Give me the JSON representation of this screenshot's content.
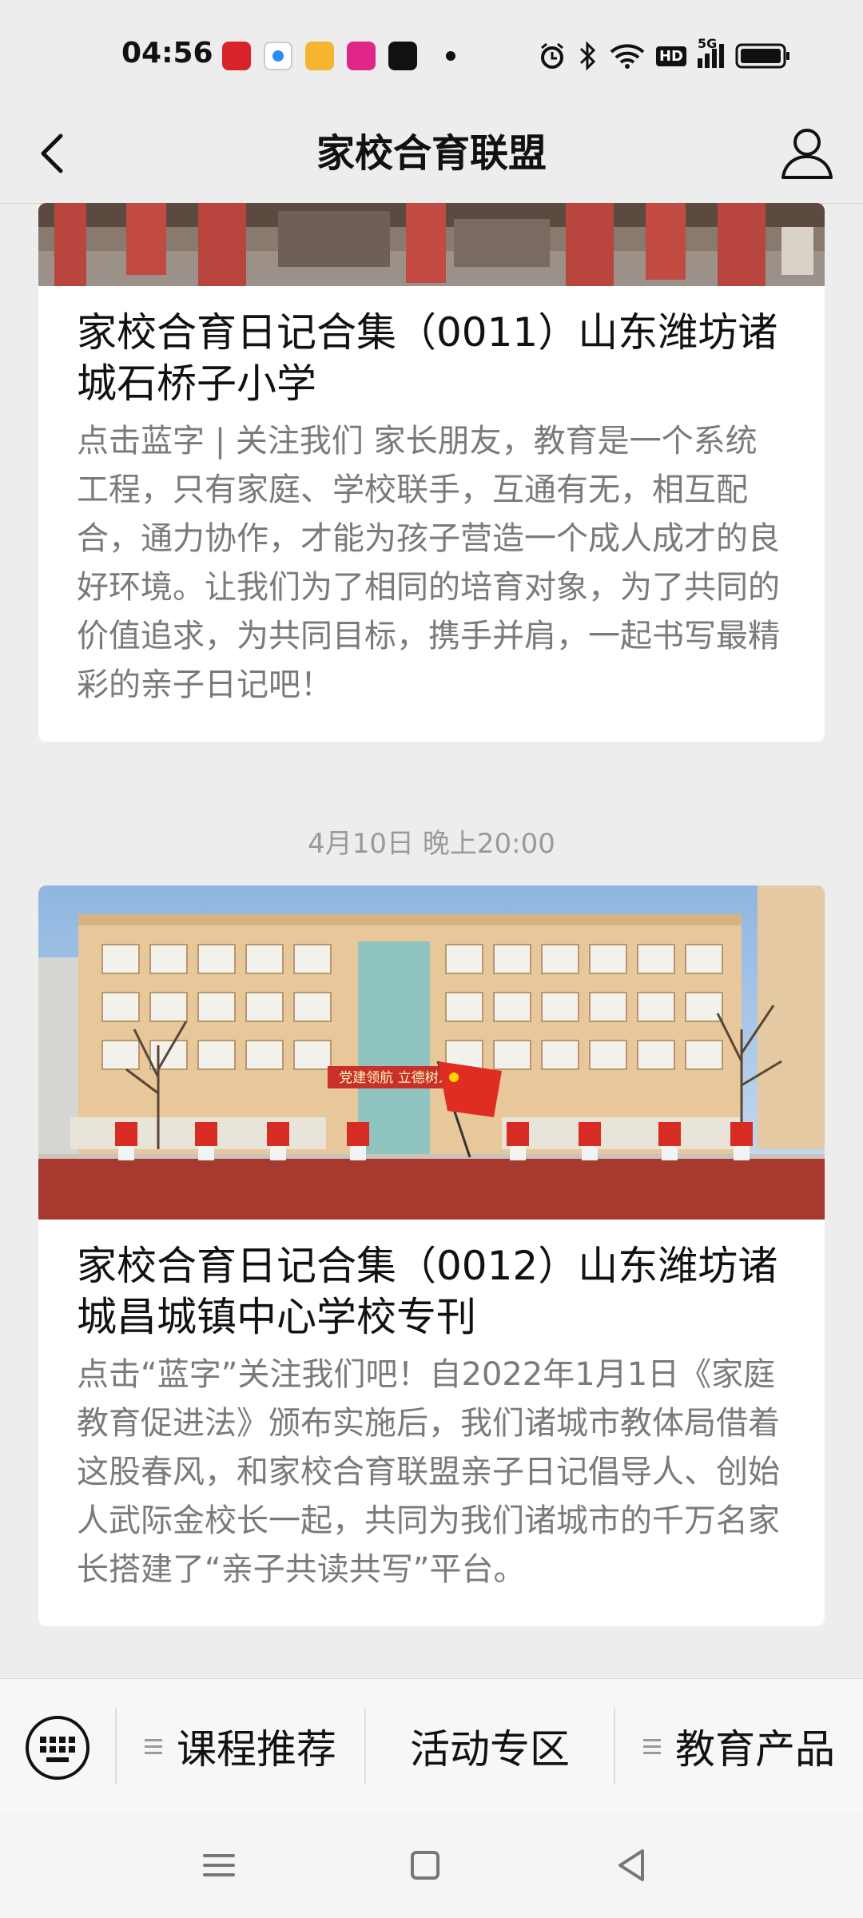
{
  "status": {
    "time": "04:56",
    "network": "5G",
    "hd": "HD"
  },
  "nav": {
    "title": "家校合育联盟"
  },
  "articles": [
    {
      "title": "家校合育日记合集（0011）山东潍坊诸城石桥子小学",
      "summary": "点击蓝字 | 关注我们 家长朋友，教育是一个系统工程，只有家庭、学校联手，互通有无，相互配合，通力协作，才能为孩子营造一个成人成才的良好环境。让我们为了相同的培育对象，为了共同的价值追求，为共同目标，携手并肩，一起书写最精彩的亲子日记吧！"
    },
    {
      "timestamp": "4月10日 晚上20:00",
      "title": "家校合育日记合集（0012）山东潍坊诸城昌城镇中心学校专刊",
      "summary": "点击“蓝字”关注我们吧！自2022年1月1日《家庭教育促进法》颁布实施后，我们诸城市教体局借着这股春风，和家校合育联盟亲子日记倡导人、创始人武际金校长一起，共同为我们诸城市的千万名家长搭建了“亲子共读共写”平台。",
      "banner_text": "党建领航 立德树人"
    }
  ],
  "menu": {
    "items": [
      {
        "label": "课程推荐",
        "has_submenu": true
      },
      {
        "label": "活动专区",
        "has_submenu": false
      },
      {
        "label": "教育产品",
        "has_submenu": true
      }
    ]
  },
  "colors": {
    "background": "#ededed",
    "card": "#ffffff",
    "summary_text": "#7a7a7a",
    "brick_red": "#b8463f",
    "track_red": "#a8392f"
  }
}
